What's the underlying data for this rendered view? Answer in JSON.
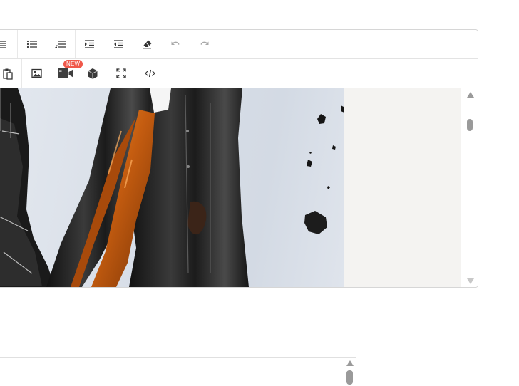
{
  "toolbar": {
    "row1": [
      {
        "name": "align-justify",
        "icon": "align-justify-icon"
      },
      {
        "name": "bulleted-list",
        "icon": "bulleted-list-icon"
      },
      {
        "name": "numbered-list",
        "icon": "numbered-list-icon"
      },
      {
        "name": "indent",
        "icon": "indent-icon"
      },
      {
        "name": "outdent",
        "icon": "outdent-icon"
      },
      {
        "name": "clear-formatting",
        "icon": "eraser-icon"
      },
      {
        "name": "undo",
        "icon": "undo-icon"
      },
      {
        "name": "redo",
        "icon": "redo-icon"
      }
    ],
    "row2": [
      {
        "name": "paste",
        "icon": "clipboard-icon"
      },
      {
        "name": "insert-image",
        "icon": "image-icon"
      },
      {
        "name": "insert-video",
        "icon": "video-camera-icon"
      },
      {
        "name": "insert-3d-object",
        "icon": "cube-icon"
      },
      {
        "name": "fullscreen",
        "icon": "fullscreen-icon"
      },
      {
        "name": "source-code",
        "icon": "code-icon"
      }
    ],
    "new_badge": "NEW"
  },
  "colors": {
    "badge": "#f0584a",
    "border": "#d6d6d6",
    "icon": "#333333",
    "icon_disabled": "#a8a8a8",
    "content_bg": "#f4f3f1"
  }
}
